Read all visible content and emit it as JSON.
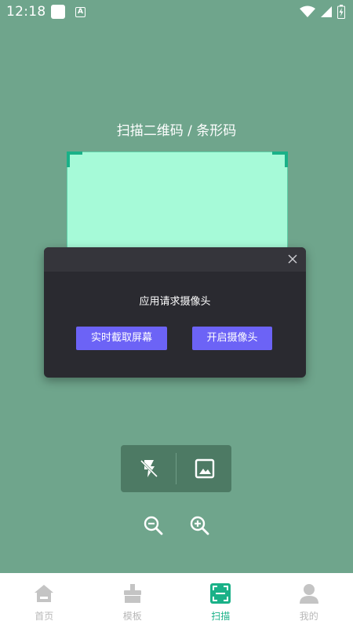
{
  "status_bar": {
    "time": "12:18",
    "notification_letter": "A"
  },
  "scan": {
    "title": "扫描二维码 / 条形码"
  },
  "dialog": {
    "message": "应用请求摄像头",
    "capture_button": "实时截取屏幕",
    "camera_button": "开启摄像头"
  },
  "nav": {
    "items": [
      {
        "label": "首页",
        "icon": "home-icon",
        "active": false
      },
      {
        "label": "模板",
        "icon": "template-icon",
        "active": false
      },
      {
        "label": "扫描",
        "icon": "scan-icon",
        "active": true
      },
      {
        "label": "我的",
        "icon": "profile-icon",
        "active": false
      }
    ]
  },
  "colors": {
    "background": "#6fa58c",
    "accent": "#1ab188",
    "dialog_button": "#6c63f6",
    "scan_area": "#a6fad8"
  }
}
